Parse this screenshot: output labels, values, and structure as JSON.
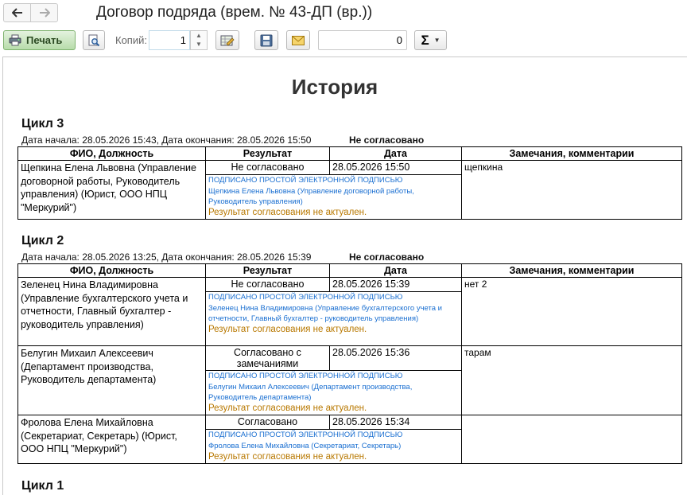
{
  "window": {
    "title": "Договор подряда (врем. № 43-ДП (вр.))"
  },
  "toolbar": {
    "print_label": "Печать",
    "copies_label": "Копий:",
    "copies_value": "1",
    "sum_value": "0",
    "sum_symbol": "Σ"
  },
  "document": {
    "title": "История",
    "columns": {
      "person": "ФИО, Должность",
      "result": "Результат",
      "date": "Дата",
      "comments": "Замечания, комментарии"
    },
    "cycles": [
      {
        "heading": "Цикл 3",
        "dates": "Дата начала: 28.05.2026 15:43, Дата окончания: 28.05.2026 15:50",
        "status": "Не согласовано",
        "rows": [
          {
            "person": "Щепкина Елена Львовна (Управление договорной работы, Руководитель управления) (Юрист, ООО НПЦ \"Меркурий\")",
            "result": "Не согласовано",
            "date": "28.05.2026 15:50",
            "comment": "щепкина",
            "sig_head": "ПОДПИСАНО ПРОСТОЙ ЭЛЕКТРОННОЙ ПОДПИСЬЮ",
            "sig_name": "Щепкина Елена Львовна (Управление договорной работы, Руководитель управления)",
            "sig_note": "Результат согласования не актуален."
          }
        ]
      },
      {
        "heading": "Цикл 2",
        "dates": "Дата начала: 28.05.2026 13:25, Дата окончания: 28.05.2026 15:39",
        "status": "Не согласовано",
        "rows": [
          {
            "person": "Зеленец Нина Владимировна (Управление бухгалтерского учета и отчетности, Главный бухгалтер - руководитель управления)",
            "result": "Не согласовано",
            "date": "28.05.2026 15:39",
            "comment": "нет 2",
            "sig_head": "ПОДПИСАНО ПРОСТОЙ ЭЛЕКТРОННОЙ ПОДПИСЬЮ",
            "sig_name": "Зеленец Нина Владимировна (Управление бухгалтерского учета и отчетности, Главный бухгалтер - руководитель управления)",
            "sig_note": "Результат согласования не актуален."
          },
          {
            "person": "Белугин Михаил Алексеевич (Департамент производства, Руководитель департамента)",
            "result": "Согласовано с замечаниями",
            "date": "28.05.2026 15:36",
            "comment": "тарам",
            "sig_head": "ПОДПИСАНО ПРОСТОЙ ЭЛЕКТРОННОЙ ПОДПИСЬЮ",
            "sig_name": "Белугин Михаил Алексеевич (Департамент производства, Руководитель департамента)",
            "sig_note": "Результат согласования не актуален."
          },
          {
            "person": "Фролова Елена Михайловна (Секретариат, Секретарь) (Юрист, ООО НПЦ \"Меркурий\")",
            "result": "Согласовано",
            "date": "28.05.2026 15:34",
            "comment": "",
            "sig_head": "ПОДПИСАНО ПРОСТОЙ ЭЛЕКТРОННОЙ ПОДПИСЬЮ",
            "sig_name": "Фролова Елена Михайловна (Секретариат, Секретарь)",
            "sig_note": "Результат согласования не актуален."
          }
        ]
      },
      {
        "heading": "Цикл 1"
      }
    ]
  }
}
